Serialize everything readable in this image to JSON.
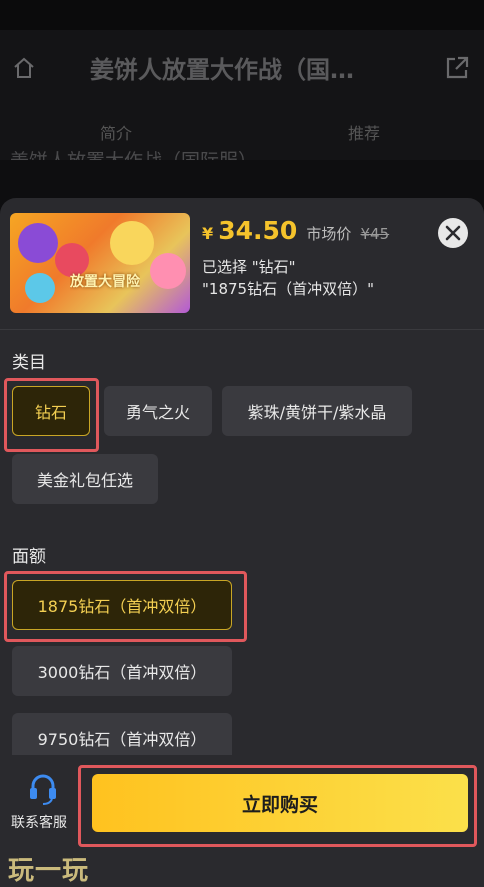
{
  "background": {
    "title": "姜饼人放置大作战（国…",
    "subtitle": "姜饼人放置大作战（国际服）",
    "tabs": [
      {
        "label": "简介"
      },
      {
        "label": "推荐"
      }
    ]
  },
  "product": {
    "image_badge_text": "放置大冒险",
    "price_symbol": "¥",
    "price": "34.50",
    "market_label": "市场价",
    "market_price": "¥45",
    "selected_line1": "已选择 \"钻石\"",
    "selected_line2": "\"1875钻石（首冲双倍）\""
  },
  "category": {
    "label": "类目",
    "options": [
      {
        "label": "钻石",
        "selected": true
      },
      {
        "label": "勇气之火",
        "selected": false
      },
      {
        "label": "紫珠/黄饼干/紫水晶",
        "selected": false
      },
      {
        "label": "美金礼包任选",
        "selected": false
      }
    ]
  },
  "denomination": {
    "label": "面额",
    "options": [
      {
        "label": "1875钻石（首冲双倍）",
        "selected": true
      },
      {
        "label": "3000钻石（首冲双倍）",
        "selected": false
      },
      {
        "label": "9750钻石（首冲双倍）",
        "selected": false
      }
    ]
  },
  "footer": {
    "support_label": "联系客服",
    "buy_label": "立即购买"
  },
  "watermark": "玩一玩",
  "colors": {
    "accent": "#f5c32c",
    "sheet_bg": "#2a2a2e",
    "chip_bg": "#3a3a3f",
    "highlight": "#e0585c"
  }
}
